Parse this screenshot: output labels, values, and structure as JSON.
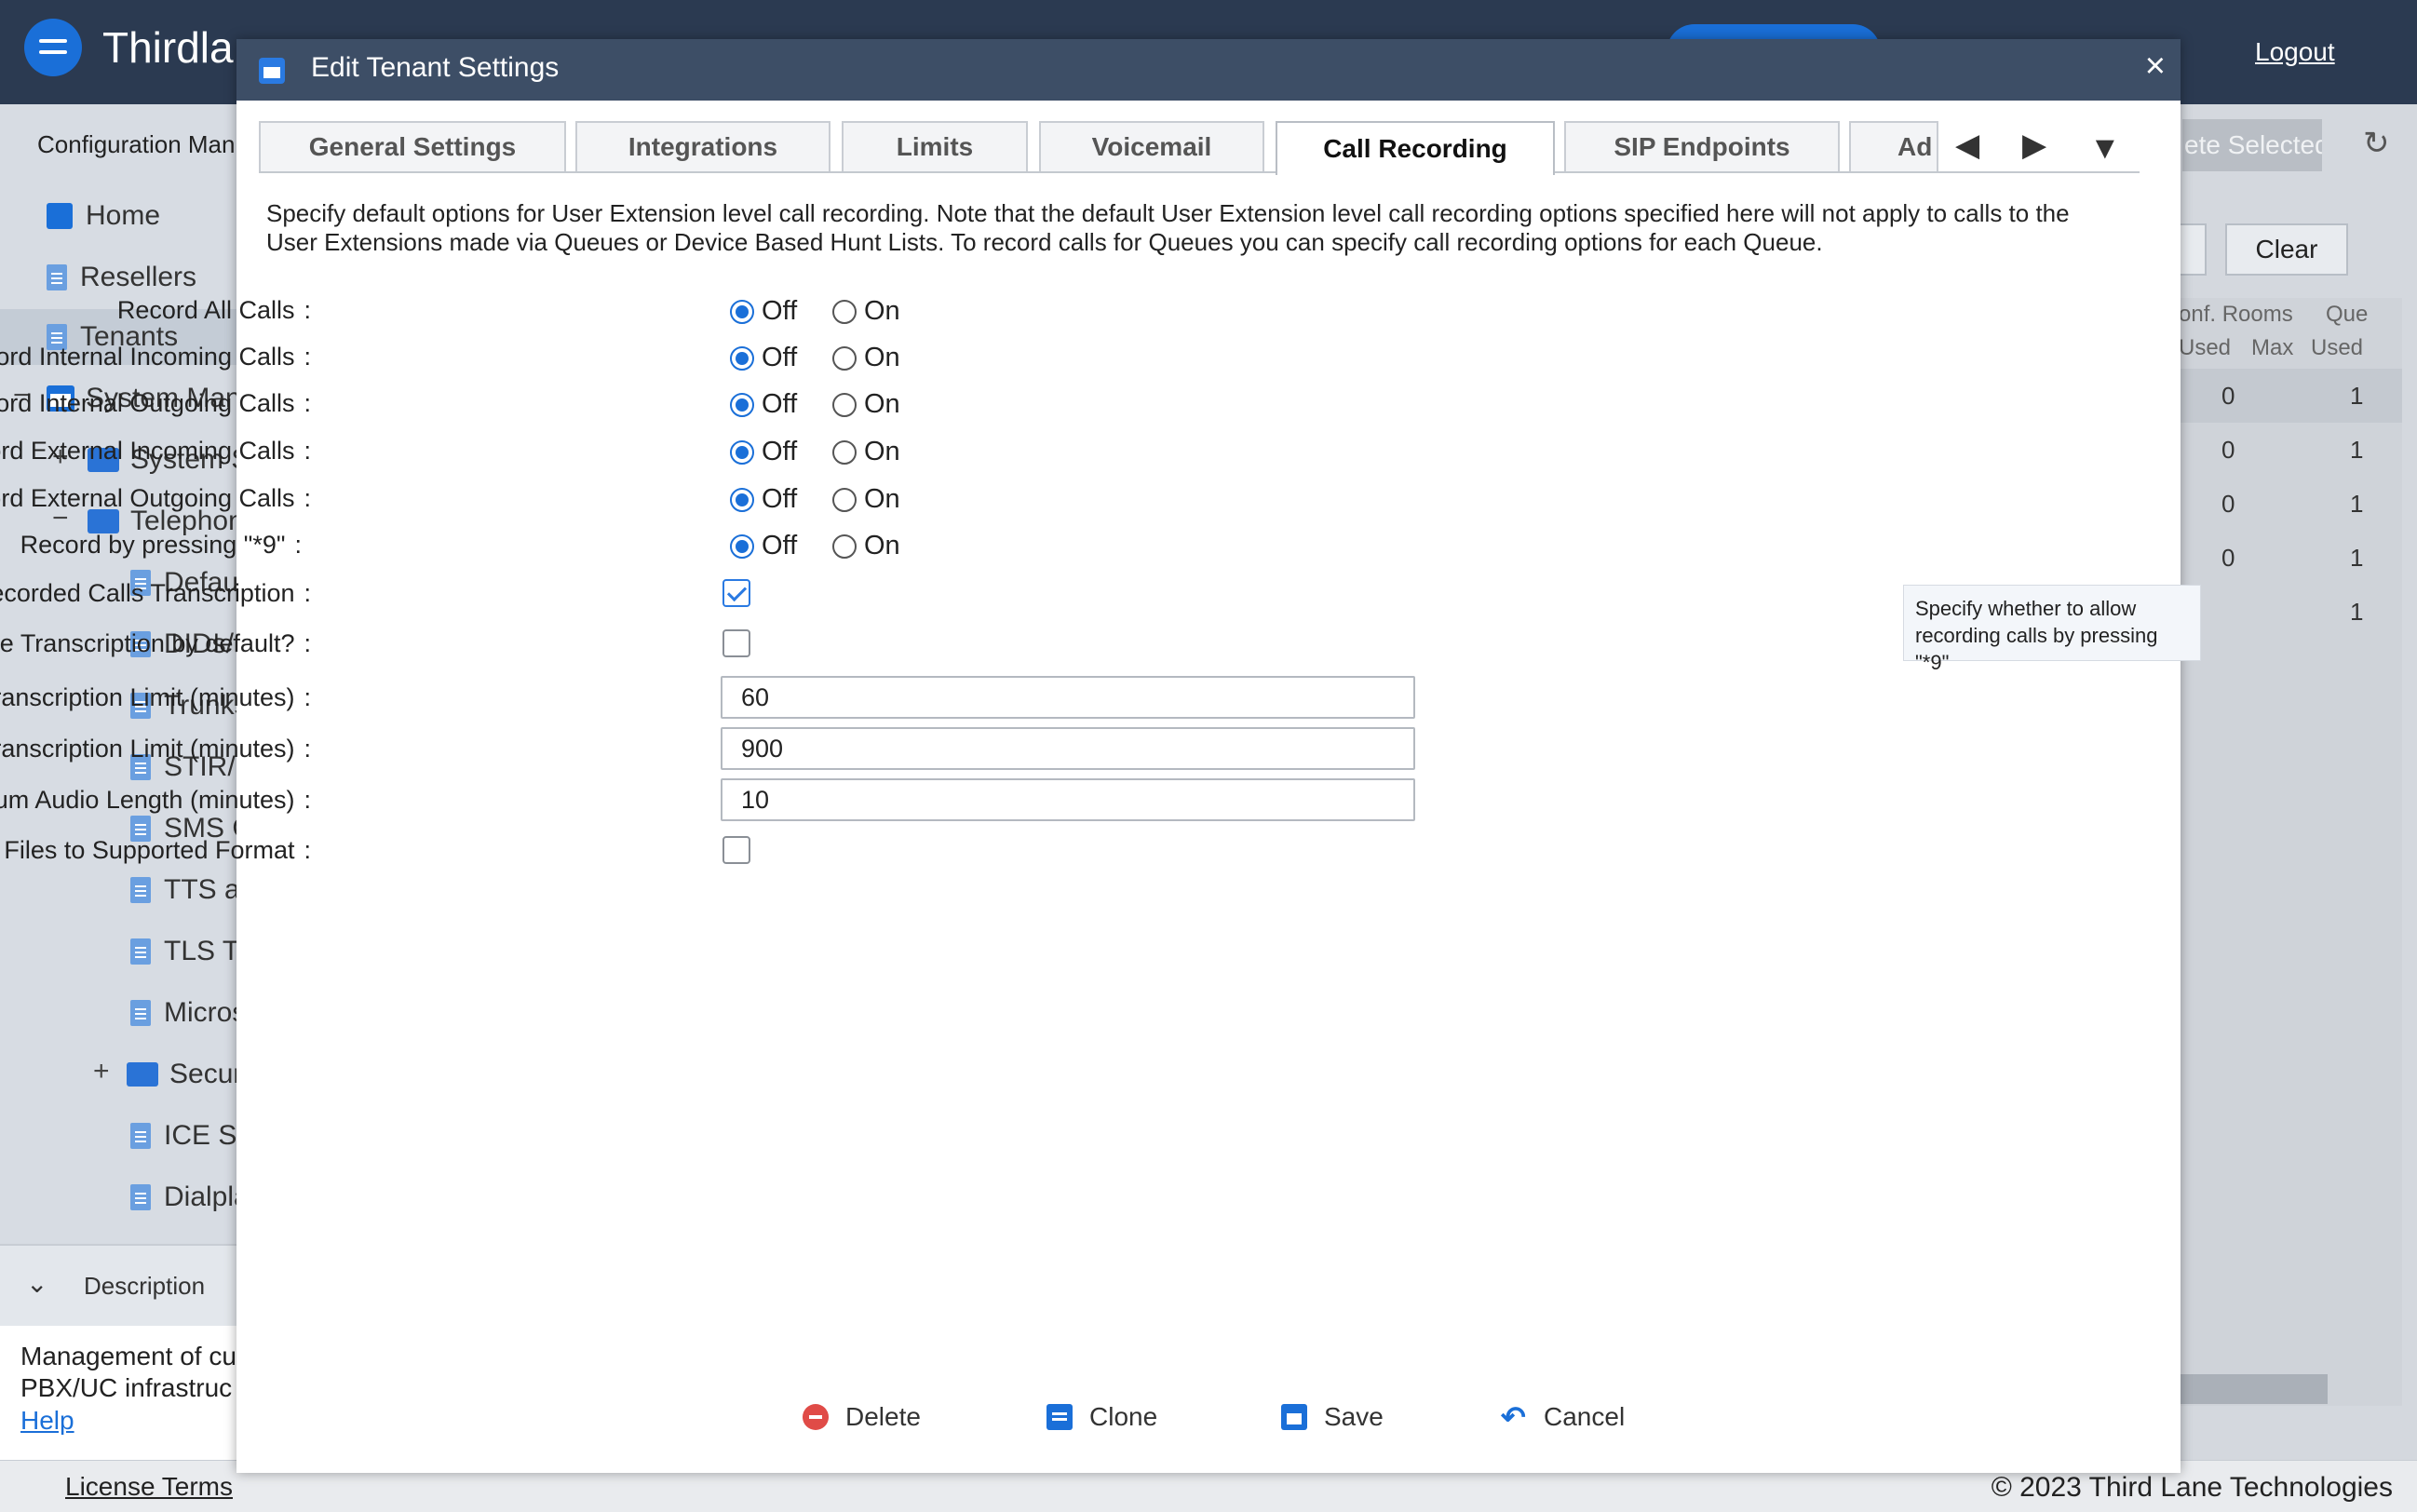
{
  "app": {
    "brand_partial": "Thirdla",
    "logout_label": "Logout"
  },
  "left_panel": {
    "title": "Configuration Man",
    "items": [
      {
        "label": "Home"
      },
      {
        "label": "Resellers"
      },
      {
        "label": "Tenants"
      },
      {
        "label": "System Mana"
      },
      {
        "label": "System S"
      },
      {
        "label": "Telephony"
      },
      {
        "label": "Defau"
      },
      {
        "label": "DIDs/I"
      },
      {
        "label": "Trunks"
      },
      {
        "label": "STIR/S"
      },
      {
        "label": "SMS C"
      },
      {
        "label": "TTS a"
      },
      {
        "label": "TLS Tr"
      },
      {
        "label": "Micros"
      },
      {
        "label": "Securi"
      },
      {
        "label": "ICE Se"
      },
      {
        "label": "Dialpla"
      }
    ],
    "description_label": "Description",
    "description_lines": [
      "Management of cu",
      "PBX/UC infrastruc"
    ],
    "help_label": "Help"
  },
  "right_panel": {
    "delete_selected_partial": "ete Selected",
    "clear_label": "Clear",
    "headers": {
      "conf_rooms": "onf. Rooms",
      "queues": "Que",
      "used": "Used",
      "max": "Max",
      "used2": "Used"
    },
    "rows": [
      {
        "conf_used": "0",
        "queue_used": "1"
      },
      {
        "conf_used": "0",
        "queue_used": "1"
      },
      {
        "conf_used": "0",
        "queue_used": "1"
      },
      {
        "conf_used": "0",
        "queue_used": "1"
      },
      {
        "conf_used": "",
        "queue_used": "1"
      }
    ]
  },
  "footer": {
    "license_label": "License Terms",
    "copyright": "© 2023 Third Lane Technologies"
  },
  "modal": {
    "title": "Edit Tenant Settings",
    "close_glyph": "×",
    "tabs": [
      {
        "label": "General Settings",
        "active": false
      },
      {
        "label": "Integrations",
        "active": false
      },
      {
        "label": "Limits",
        "active": false
      },
      {
        "label": "Voicemail",
        "active": false
      },
      {
        "label": "Call Recording",
        "active": true
      },
      {
        "label": "SIP Endpoints",
        "active": false
      },
      {
        "label": "Ad",
        "active": false
      }
    ],
    "intro_lines": [
      "Specify default options for User Extension level call recording. Note that the default User Extension level call recording options specified here will not apply to calls to the",
      "User Extensions made via Queues or Device Based Hunt Lists. To record calls for Queues you can specify call recording options for each Queue."
    ],
    "radio_fields": [
      {
        "label": "Record All Calls",
        "off": "Off",
        "on": "On",
        "value": "off"
      },
      {
        "label": "Record Internal Incoming Calls",
        "off": "Off",
        "on": "On",
        "value": "off"
      },
      {
        "label": "Record Internal Outgoing Calls",
        "off": "Off",
        "on": "On",
        "value": "off"
      },
      {
        "label": "Record External Incoming Calls",
        "off": "Off",
        "on": "On",
        "value": "off"
      },
      {
        "label": "Record External Outgoing Calls",
        "off": "Off",
        "on": "On",
        "value": "off"
      },
      {
        "label": "Record by pressing \"*9\"",
        "off": "Off",
        "on": "On",
        "value": "off"
      }
    ],
    "checkbox_fields": [
      {
        "label": "Allow Recorded Calls Transcription",
        "checked": true
      },
      {
        "label": "Enable Transcription by default?",
        "checked": false
      }
    ],
    "text_fields": [
      {
        "label": "Daily Transcription Limit (minutes)",
        "value": "60"
      },
      {
        "label": "Monthly Transcription Limit (minutes)",
        "value": "900"
      },
      {
        "label": "Maximum Audio Length (minutes)",
        "value": "10"
      }
    ],
    "convert_field": {
      "label": "Convert Files to Supported Format",
      "checked": false
    },
    "colon": ":",
    "tooltip_lines": [
      "Specify whether to allow",
      "recording calls by pressing \"*9\""
    ],
    "actions": {
      "delete": "Delete",
      "clone": "Clone",
      "save": "Save",
      "cancel": "Cancel"
    }
  }
}
